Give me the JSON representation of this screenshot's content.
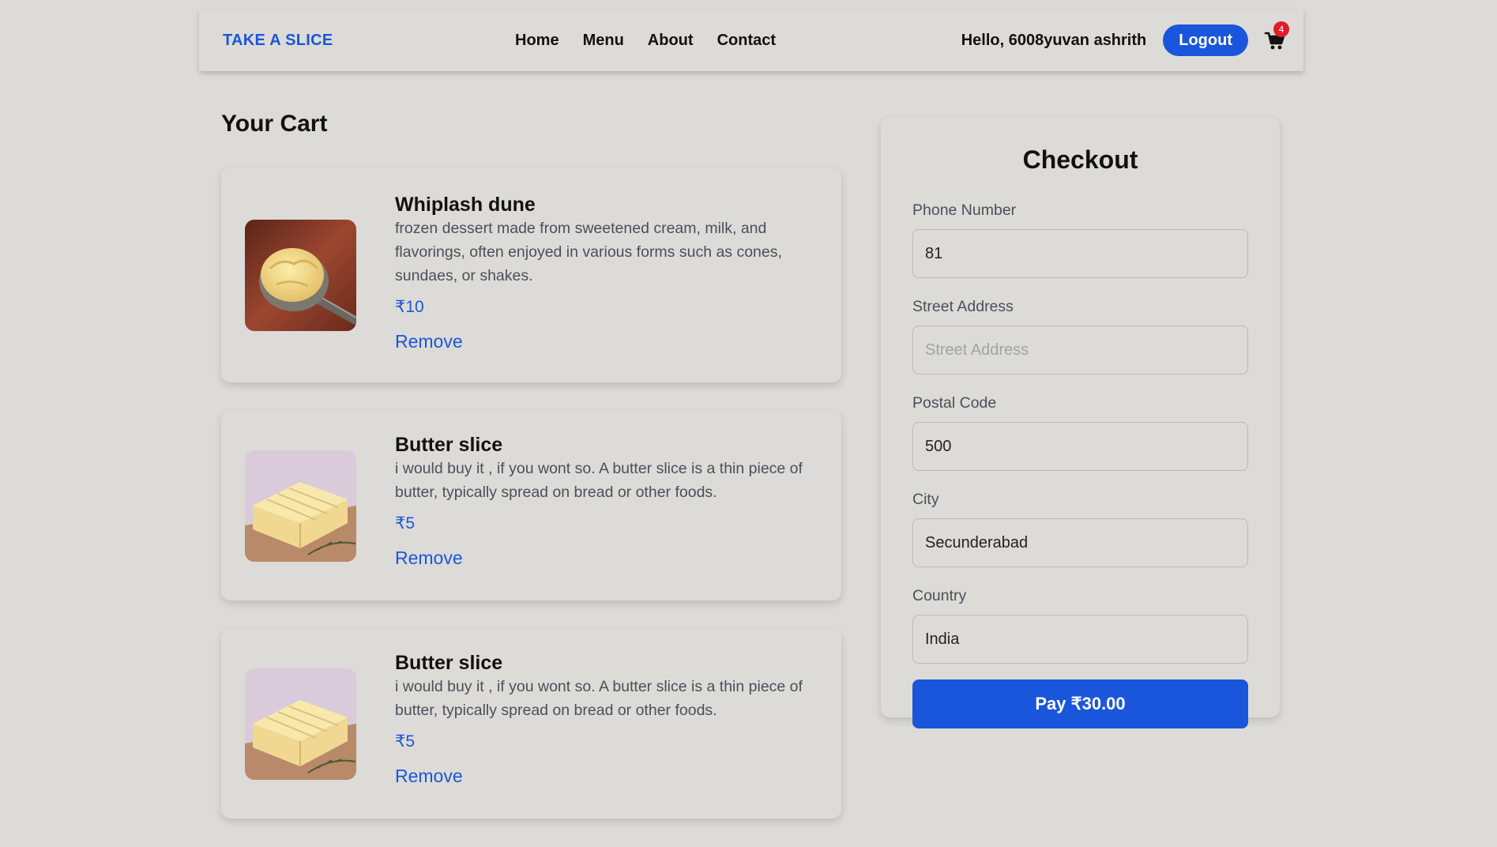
{
  "navbar": {
    "brand": "TAKE A SLICE",
    "links": [
      "Home",
      "Menu",
      "About",
      "Contact"
    ],
    "greeting": "Hello, 6008yuvan ashrith",
    "logout_label": "Logout",
    "cart_count": "4"
  },
  "cart": {
    "title": "Your Cart",
    "items": [
      {
        "name": "Whiplash dune",
        "description": "frozen dessert made from sweetened cream, milk, and flavorings, often enjoyed in various forms such as cones, sundaes, or shakes.",
        "price": "₹10",
        "remove_label": "Remove",
        "image": "ice-cream-scoop-image"
      },
      {
        "name": "Butter slice",
        "description": "i would buy it , if you wont so. A butter slice is a thin piece of butter, typically spread on bread or other foods.",
        "price": "₹5",
        "remove_label": "Remove",
        "image": "butter-block-image"
      },
      {
        "name": "Butter slice",
        "description": "i would buy it , if you wont so. A butter slice is a thin piece of butter, typically spread on bread or other foods.",
        "price": "₹5",
        "remove_label": "Remove",
        "image": "butter-block-image"
      }
    ]
  },
  "checkout": {
    "title": "Checkout",
    "phone": {
      "label": "Phone Number",
      "value": "81",
      "placeholder": "Phone Number"
    },
    "street": {
      "label": "Street Address",
      "value": "",
      "placeholder": "Street Address"
    },
    "postal": {
      "label": "Postal Code",
      "value": "500",
      "placeholder": "Postal Code"
    },
    "city": {
      "label": "City",
      "value": "Secunderabad",
      "placeholder": "City"
    },
    "country": {
      "label": "Country",
      "value": "India",
      "placeholder": "Country"
    },
    "pay_label": "Pay ₹30.00"
  },
  "colors": {
    "background": "#dcdbd7",
    "accent": "#1a56db",
    "badge": "#e11d2a"
  }
}
